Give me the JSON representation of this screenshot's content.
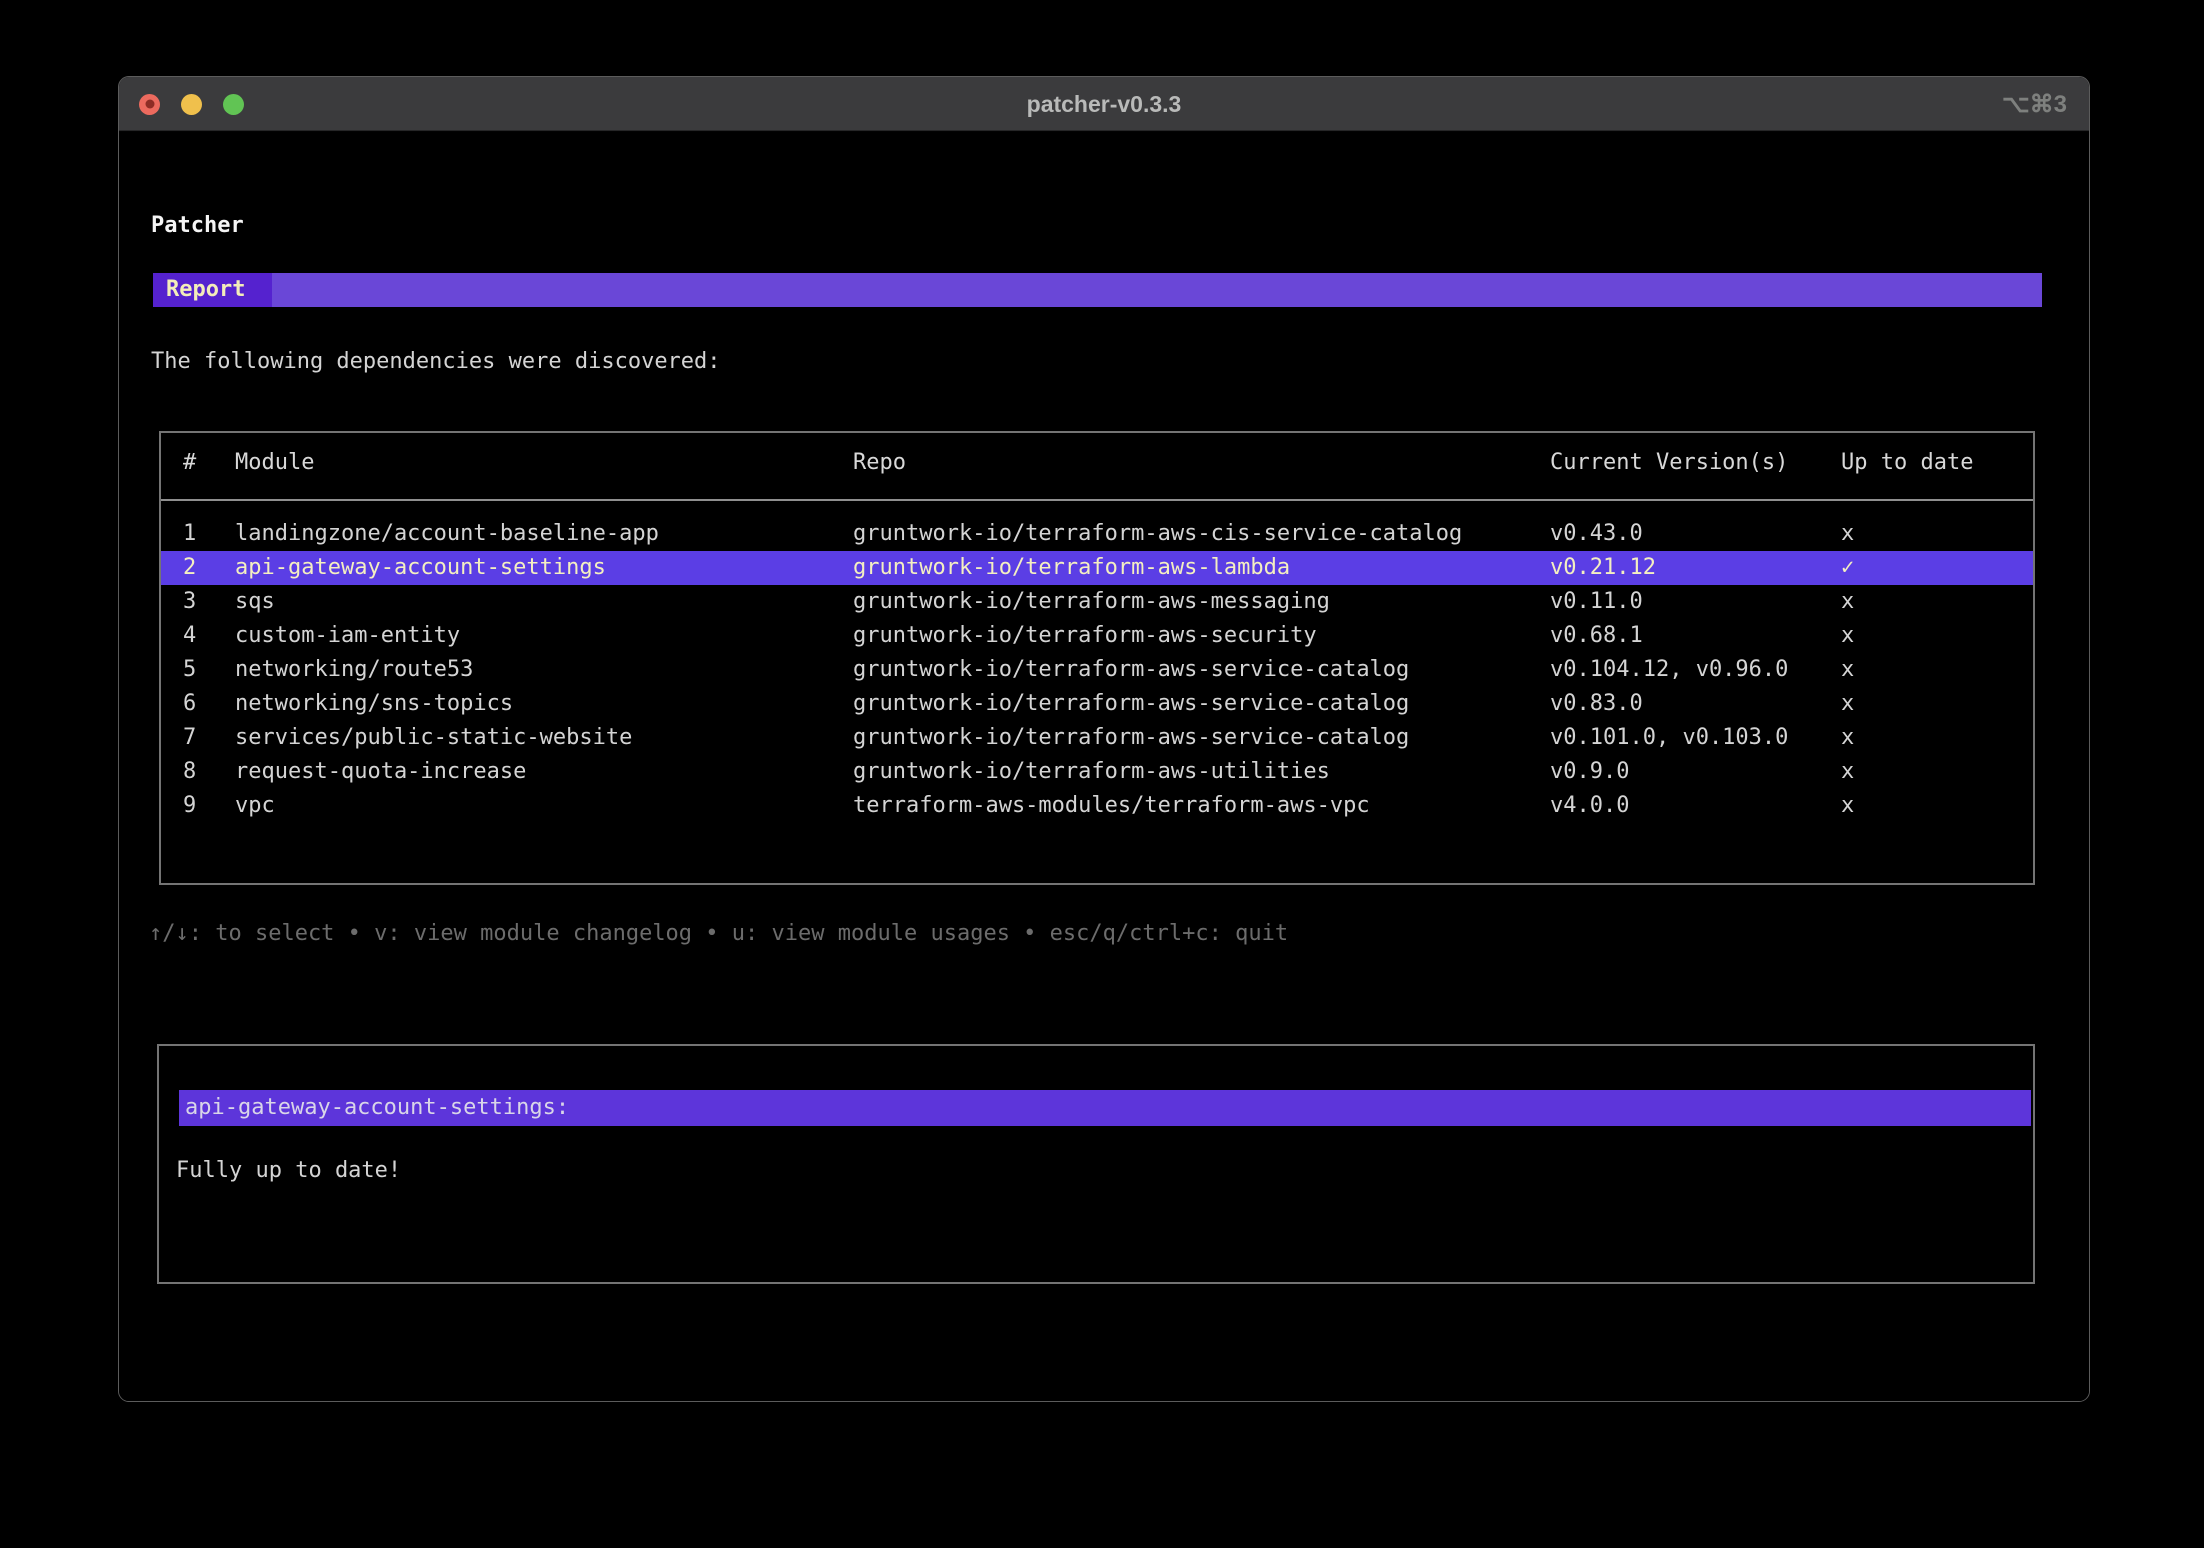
{
  "window": {
    "title": "patcher-v0.3.3",
    "shortcut": "⌥⌘3"
  },
  "app": {
    "heading": "Patcher",
    "tab_label": "Report",
    "intro": "The following dependencies were discovered:",
    "hints": "↑/↓: to select • v: view module changelog • u: view module usages • esc/q/ctrl+c: quit"
  },
  "colors": {
    "tab_bg": "#5522cf",
    "tab_bar_bg": "#6a47d7",
    "selected_row_bg": "#5b3ee5",
    "selected_text": "#f4efc1",
    "detail_bar_bg": "#5d35da",
    "terminal_text": "#d4d4d4",
    "dim_text": "#6c6c6c",
    "border_gray": "#747474"
  },
  "table": {
    "columns": [
      "#",
      "Module",
      "Repo",
      "Current Version(s)",
      "Up to date"
    ],
    "rows": [
      {
        "num": "1",
        "module": "landingzone/account-baseline-app",
        "repo": "gruntwork-io/terraform-aws-cis-service-catalog",
        "versions": "v0.43.0",
        "up_to_date": "x",
        "selected": false
      },
      {
        "num": "2",
        "module": "api-gateway-account-settings",
        "repo": "gruntwork-io/terraform-aws-lambda",
        "versions": "v0.21.12",
        "up_to_date": "✓",
        "selected": true
      },
      {
        "num": "3",
        "module": "sqs",
        "repo": "gruntwork-io/terraform-aws-messaging",
        "versions": "v0.11.0",
        "up_to_date": "x",
        "selected": false
      },
      {
        "num": "4",
        "module": "custom-iam-entity",
        "repo": "gruntwork-io/terraform-aws-security",
        "versions": "v0.68.1",
        "up_to_date": "x",
        "selected": false
      },
      {
        "num": "5",
        "module": "networking/route53",
        "repo": "gruntwork-io/terraform-aws-service-catalog",
        "versions": "v0.104.12, v0.96.0",
        "up_to_date": "x",
        "selected": false
      },
      {
        "num": "6",
        "module": "networking/sns-topics",
        "repo": "gruntwork-io/terraform-aws-service-catalog",
        "versions": "v0.83.0",
        "up_to_date": "x",
        "selected": false
      },
      {
        "num": "7",
        "module": "services/public-static-website",
        "repo": "gruntwork-io/terraform-aws-service-catalog",
        "versions": "v0.101.0, v0.103.0",
        "up_to_date": "x",
        "selected": false
      },
      {
        "num": "8",
        "module": "request-quota-increase",
        "repo": "gruntwork-io/terraform-aws-utilities",
        "versions": "v0.9.0",
        "up_to_date": "x",
        "selected": false
      },
      {
        "num": "9",
        "module": "vpc",
        "repo": "terraform-aws-modules/terraform-aws-vpc",
        "versions": "v4.0.0",
        "up_to_date": "x",
        "selected": false
      }
    ]
  },
  "detail": {
    "header": "api-gateway-account-settings:",
    "body": "Fully up to date!"
  }
}
